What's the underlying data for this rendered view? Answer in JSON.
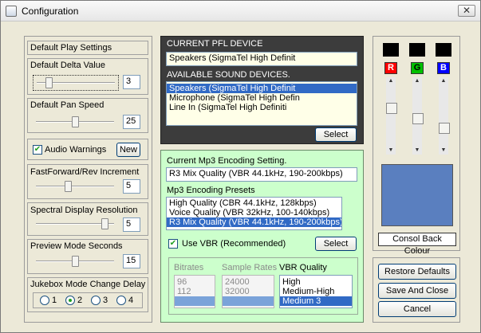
{
  "window": {
    "title": "Configuration",
    "close": "✕"
  },
  "left": {
    "default_play": {
      "header": "Default Play Settings"
    },
    "delta": {
      "label": "Default Delta Value",
      "value": "3",
      "slider_level": 0.12
    },
    "pan": {
      "label": "Default Pan Speed",
      "value": "25",
      "slider_level": 0.5
    },
    "audio": {
      "label": "Audio Warnings",
      "checked": true,
      "new_button": "New"
    },
    "ffrev": {
      "label": "FastForward/Rev Increment",
      "value": "5",
      "slider_level": 0.4
    },
    "spectral": {
      "label": "Spectral Display Resolution",
      "value": "5",
      "slider_level": 0.92
    },
    "preview": {
      "label": "Preview Mode Seconds",
      "value": "15",
      "slider_level": 0.5
    },
    "jukebox": {
      "label": "Jukebox Mode Change Delay",
      "options": [
        "1",
        "2",
        "3",
        "4"
      ],
      "selected": "2"
    }
  },
  "pfl": {
    "current_label": "CURRENT PFL DEVICE",
    "current_value": "Speakers (SigmaTel High Definit",
    "available_label": "AVAILABLE SOUND DEVICES.",
    "devices": [
      "Speakers (SigmaTel High Definit",
      "Microphone (SigmaTel High Defin",
      "Line In (SigmaTel High Definiti"
    ],
    "selected_index": 0,
    "select_button": "Select",
    "bg_color": "#3c3c3c",
    "list_bg": "#ffffe8"
  },
  "mp3": {
    "current_label": "Current Mp3 Encoding Setting.",
    "current_value": "R3 Mix Quality (VBR 44.1kHz, 190-200kbps)",
    "presets_label": "Mp3 Encoding Presets",
    "presets": [
      "High Quality (CBR 44.1kHz, 128kbps)",
      "Voice Quality (VBR 32kHz, 100-140kbps)",
      "R3 Mix Quality (VBR 44.1kHz, 190-200kbps)"
    ],
    "presets_selected": 2,
    "use_vbr_label": "Use VBR  (Recommended)",
    "use_vbr_checked": true,
    "select_button": "Select",
    "bitrates_label": "Bitrates",
    "bitrates": [
      "96",
      "112",
      ""
    ],
    "sample_rates_label": "Sample Rates",
    "sample_rates": [
      "24000",
      "32000",
      ""
    ],
    "vbr_quality_label": "VBR Quality",
    "vbr_quality": [
      "High",
      "Medium-High",
      "Medium 3"
    ],
    "vbr_selected": 2,
    "bg_color": "#ccffcc"
  },
  "color": {
    "r_label": "R",
    "g_label": "G",
    "b_label": "B",
    "r_color": "#ff0000",
    "g_color": "#00c000",
    "b_color": "#0000ff",
    "r_level": 0.35,
    "g_level": 0.55,
    "b_level": 0.75,
    "preview_color": "#5a7fbf",
    "back_colour_label": "Consol Back Colour"
  },
  "actions": {
    "restore": "Restore Defaults",
    "save_close": "Save And Close",
    "cancel": "Cancel"
  }
}
